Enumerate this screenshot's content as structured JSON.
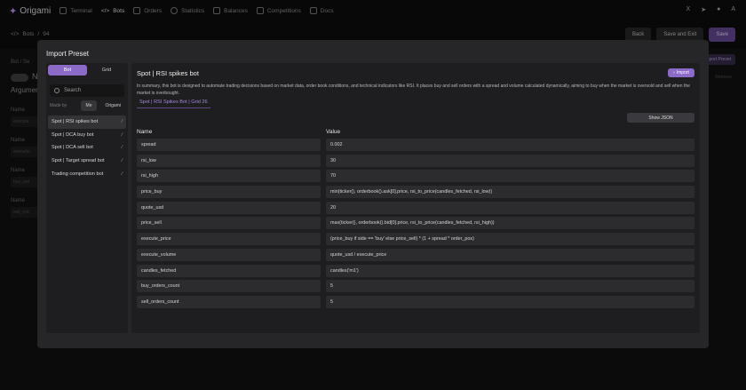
{
  "app": {
    "name": "Origami"
  },
  "nav": [
    {
      "label": "Terminal",
      "icon": "grid-icon"
    },
    {
      "label": "Bots",
      "icon": "code-icon"
    },
    {
      "label": "Orders",
      "icon": "orders-icon"
    },
    {
      "label": "Statistics",
      "icon": "chart-icon"
    },
    {
      "label": "Balances",
      "icon": "wallet-icon"
    },
    {
      "label": "Competitions",
      "icon": "trophy-icon"
    },
    {
      "label": "Docs",
      "icon": "doc-icon"
    }
  ],
  "top_right": {
    "x_label": "X",
    "lang": "A"
  },
  "breadcrumb": {
    "root": "Bots",
    "sep": "/",
    "id": "94"
  },
  "page_actions": {
    "back": "Back",
    "save_exit": "Save and Exit",
    "save": "Save"
  },
  "underlay": {
    "bot_tab": "Bot / Se",
    "heading_n": "N",
    "arguments": "Argumer",
    "import_preset": "port Preset",
    "fields": [
      {
        "label": "Name",
        "value": "execute"
      },
      {
        "label": "Name",
        "value": "executio"
      },
      {
        "label": "Name",
        "value": "buy_ord"
      },
      {
        "label": "Name",
        "value": "sell_ord"
      }
    ],
    "right_text": "Remove"
  },
  "modal": {
    "title": "Import Preset",
    "tabs": [
      "Bot",
      "Grid"
    ],
    "search_placeholder": "Search",
    "made_by_label": "Made by",
    "made_by_options": [
      "Me",
      "Origami"
    ],
    "presets": [
      "Spot | RSI spikes bot",
      "Spot | DCA buy bot",
      "Spot | DCA sell bot",
      "Spot | Target spread bot",
      "Trading competition bot"
    ],
    "detail": {
      "title": "Spot | RSI spikes bot",
      "import_label": "Import",
      "description": "In summary, this bot is designed to automate trading decisions based on market data, order book conditions, and technical indicators like RSI. It places buy and sell orders with a spread and volume calculated dynamically, aiming to buy when the market is oversold and sell when the market is overbought.",
      "tag": "Spot | RSI Spikes Bot | Grid 26",
      "show_json": "Show JSON",
      "columns": {
        "name": "Name",
        "value": "Value"
      },
      "params": [
        {
          "name": "spread",
          "value": "0.002"
        },
        {
          "name": "rsi_low",
          "value": "30"
        },
        {
          "name": "rsi_high",
          "value": "70"
        },
        {
          "name": "price_buy",
          "value": "min(ticker(), orderbook().ask[0].price, rsi_to_price(candles_fetched, rsi_low))"
        },
        {
          "name": "quote_usd",
          "value": "20"
        },
        {
          "name": "price_sell",
          "value": "max(ticker(), orderbook().bid[0].price, rsi_to_price(candles_fetched, rsi_high))"
        },
        {
          "name": "execute_price",
          "value": "(price_buy if side == 'buy' else price_sell) * (1 + spread * order_pos)"
        },
        {
          "name": "execute_volume",
          "value": "quote_usd / execute_price"
        },
        {
          "name": "candles_fetched",
          "value": "candles('m1')"
        },
        {
          "name": "buy_orders_count",
          "value": "5"
        },
        {
          "name": "sell_orders_count",
          "value": "5"
        }
      ]
    }
  },
  "colors": {
    "accent": "#8b6bc7",
    "background": "#0e0e0f",
    "modal": "#262628",
    "panel": "#1e1e20"
  }
}
